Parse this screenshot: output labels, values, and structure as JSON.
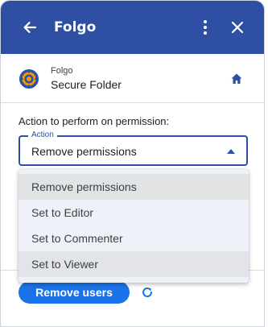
{
  "header": {
    "title": "Folgo",
    "back_icon": "arrow-left-icon",
    "more_icon": "more-vert-icon",
    "close_icon": "close-icon",
    "background": "#2e4fa3"
  },
  "app_row": {
    "small_label": "Folgo",
    "name": "Secure Folder",
    "logo_icon": "folgo-logo-icon",
    "home_icon": "home-icon"
  },
  "form": {
    "prompt": "Action to perform on permission:",
    "select_legend": "Action",
    "select_value": "Remove permissions",
    "options": [
      "Remove permissions",
      "Set to Editor",
      "Set to Commenter",
      "Set to Viewer"
    ]
  },
  "footer": {
    "primary_button": "Remove users",
    "refresh_icon": "refresh-icon",
    "accent": "#1a73e8"
  }
}
